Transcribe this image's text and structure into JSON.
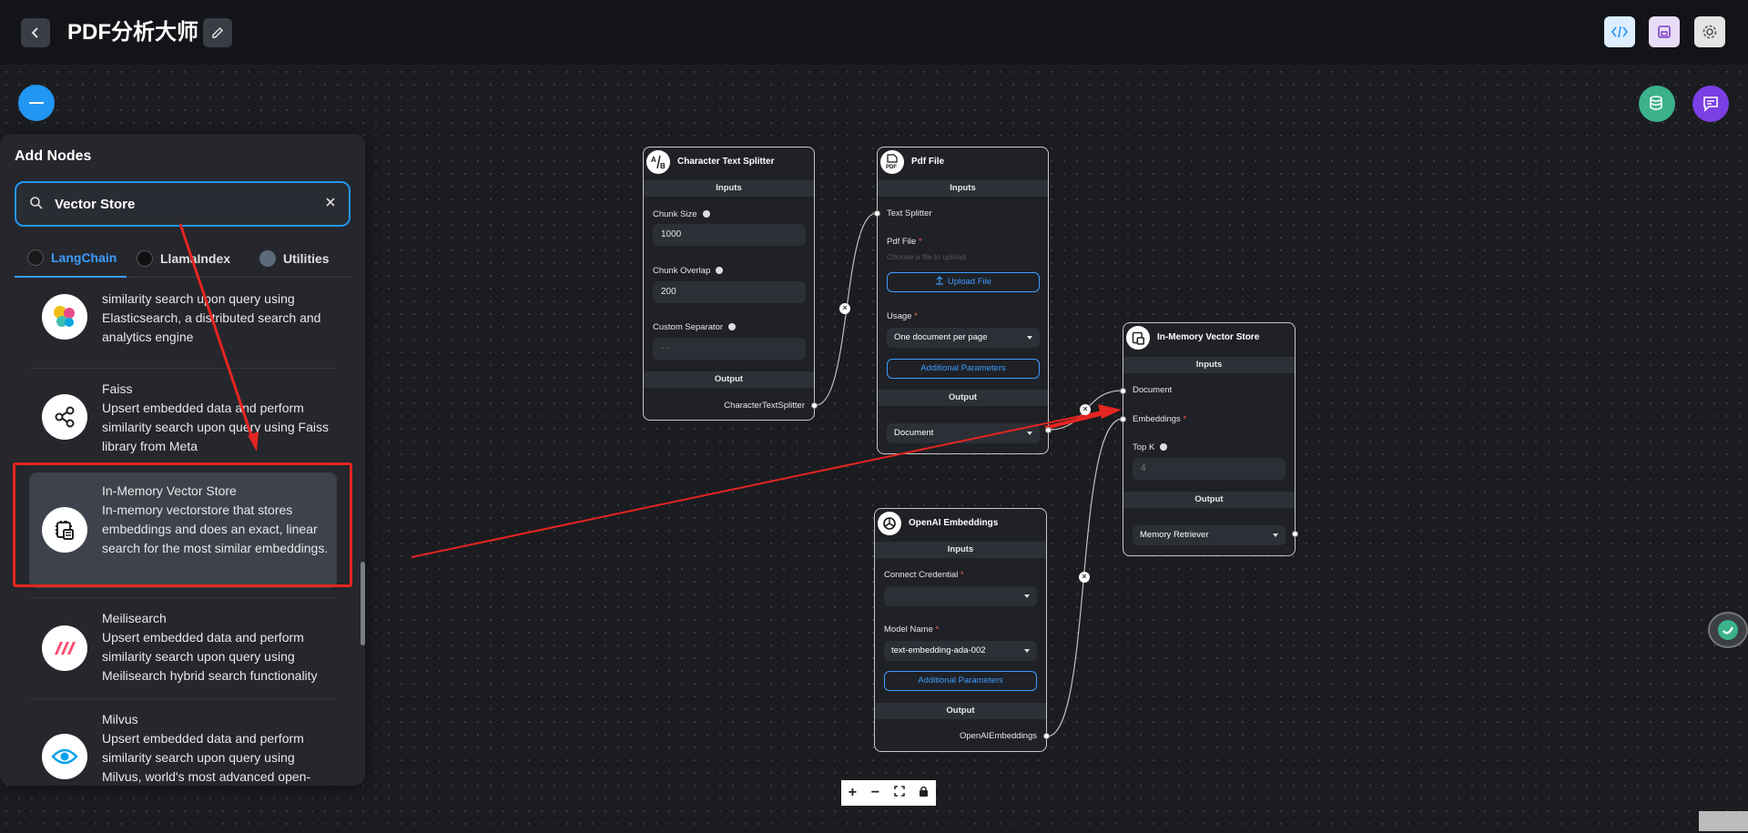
{
  "header": {
    "title": "PDF分析大师"
  },
  "add_nodes": {
    "title": "Add Nodes",
    "search_value": "Vector Store",
    "tabs": [
      {
        "label": "LangChain",
        "active": true
      },
      {
        "label": "LlamaIndex",
        "active": false
      },
      {
        "label": "Utilities",
        "active": false
      }
    ],
    "items": [
      {
        "name": "",
        "desc": "similarity search upon query using Elasticsearch, a distributed search and analytics engine"
      },
      {
        "name": "Faiss",
        "desc": "Upsert embedded data and perform similarity search upon query using Faiss library from Meta"
      },
      {
        "name": "In-Memory Vector Store",
        "desc": "In-memory vectorstore that stores embeddings and does an exact, linear search for the most similar embeddings."
      },
      {
        "name": "Meilisearch",
        "desc": "Upsert embedded data and perform similarity search upon query using Meilisearch hybrid search functionality"
      },
      {
        "name": "Milvus",
        "desc": "Upsert embedded data and perform similarity search upon query using Milvus, world's most advanced open-"
      }
    ]
  },
  "nodes": {
    "splitter": {
      "title": "Character Text Splitter",
      "inputs": "Inputs",
      "chunk_size_label": "Chunk Size",
      "chunk_size": "1000",
      "chunk_overlap_label": "Chunk Overlap",
      "chunk_overlap": "200",
      "separator_label": "Custom Separator",
      "separator": "- -",
      "output": "Output",
      "output_name": "CharacterTextSplitter"
    },
    "pdf": {
      "title": "Pdf File",
      "inputs": "Inputs",
      "text_splitter_label": "Text Splitter",
      "pdf_file_label": "Pdf File",
      "pdf_placeholder": "Choose a file to upload",
      "upload_label": "Upload File",
      "usage_label": "Usage",
      "usage_value": "One document per page",
      "additional_params": "Additional Parameters",
      "output": "Output",
      "output_value": "Document"
    },
    "memory": {
      "title": "In-Memory Vector Store",
      "inputs": "Inputs",
      "document_label": "Document",
      "embeddings_label": "Embeddings",
      "topk_label": "Top K",
      "topk_placeholder": "4",
      "output": "Output",
      "output_value": "Memory Retriever"
    },
    "openai": {
      "title": "OpenAI Embeddings",
      "inputs": "Inputs",
      "credential_label": "Connect Credential",
      "model_label": "Model Name",
      "model_value": "text-embedding-ada-002",
      "additional_params": "Additional Parameters",
      "output": "Output",
      "output_name": "OpenAIEmbeddings"
    }
  },
  "colors": {
    "accent": "#2196f3",
    "highlight": "#e52521",
    "canvas": "#1b1c20",
    "panel": "#25272d"
  },
  "icons": {
    "back": "chevron-left-icon",
    "edit": "pencil-icon",
    "code": "code-icon",
    "save": "save-icon",
    "settings": "gear-icon",
    "collapse": "minus-icon",
    "upsert": "database-icon",
    "chat": "chat-icon"
  }
}
